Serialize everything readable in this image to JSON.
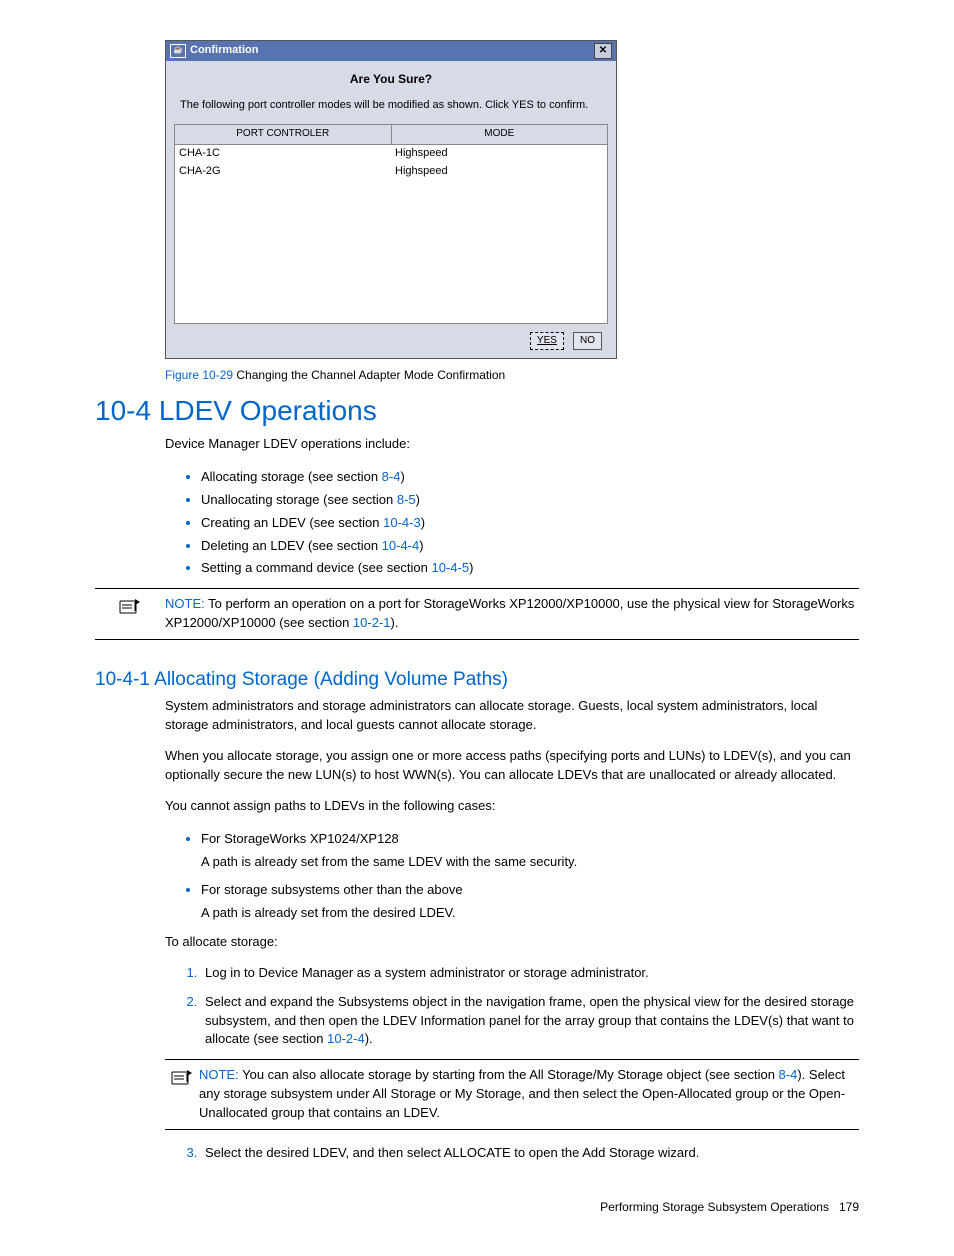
{
  "dialog": {
    "title": "Confirmation",
    "close_glyph": "✕",
    "heading": "Are You Sure?",
    "message": "The following port controller modes will be modified as shown. Click YES to confirm.",
    "columns": {
      "c1": "PORT CONTROLER",
      "c2": "MODE"
    },
    "rows": [
      {
        "controller": "CHA-1C",
        "mode": "Highspeed"
      },
      {
        "controller": "CHA-2G",
        "mode": "Highspeed"
      }
    ],
    "yes": "YES",
    "no": "NO"
  },
  "figure": {
    "number": "Figure 10-29",
    "caption": " Changing the Channel Adapter Mode Confirmation"
  },
  "section": {
    "title": "10-4 LDEV Operations"
  },
  "intro": "Device Manager LDEV operations include:",
  "ops": {
    "b1a": "Allocating storage (see section ",
    "b1x": "8-4",
    "b1b": ")",
    "b2a": "Unallocating storage (see section ",
    "b2x": "8-5",
    "b2b": ")",
    "b3a": "Creating an LDEV (see section ",
    "b3x": "10-4-3",
    "b3b": ")",
    "b4a": "Deleting an LDEV (see section ",
    "b4x": "10-4-4",
    "b4b": ")",
    "b5a": "Setting a command device (see section ",
    "b5x": "10-4-5",
    "b5b": ")"
  },
  "note1": {
    "label": "NOTE:",
    "t1": "  To perform an operation on a port for StorageWorks XP12000/XP10000, use the physical view for StorageWorks XP12000/XP10000 (see section ",
    "x": "10-2-1",
    "t2": ")."
  },
  "subsection": {
    "title": "10-4-1 Allocating Storage (Adding Volume Paths)"
  },
  "p1": "System administrators and storage administrators can allocate storage. Guests, local system administrators, local storage administrators, and local guests cannot allocate storage.",
  "p2": "When you allocate storage, you assign one or more access paths (specifying ports and LUNs) to LDEV(s), and you can optionally secure the new LUN(s) to host WWN(s). You can allocate LDEVs that are unallocated or already allocated.",
  "p3": "You cannot assign paths to LDEVs in the following cases:",
  "cases": {
    "c1": "For StorageWorks XP1024/XP128",
    "c1s": "A path is already set from the same LDEV with the same security.",
    "c2": "For storage subsystems other than the above",
    "c2s": "A path is already set from the desired LDEV."
  },
  "p4": "To allocate storage:",
  "steps": {
    "s1": "Log in to Device Manager as a system administrator or storage administrator.",
    "s2a": "Select and expand the Subsystems object in the navigation frame, open the physical view for the desired storage subsystem, and then open the LDEV Information panel for the array group that contains the LDEV(s) that want to allocate (see section ",
    "s2x": "10-2-4",
    "s2b": ").",
    "s3": "Select the desired LDEV, and then select ALLOCATE to open the Add Storage wizard."
  },
  "note2": {
    "label": "NOTE:",
    "t1": "  You can also allocate storage by starting from the All Storage/My Storage object (see section ",
    "x": "8-4",
    "t2": "). Select any storage subsystem under All Storage or My Storage, and then select the Open-Allocated group or the Open-Unallocated group that contains an LDEV."
  },
  "footer": {
    "text": "Performing Storage Subsystem Operations",
    "page": "179"
  }
}
